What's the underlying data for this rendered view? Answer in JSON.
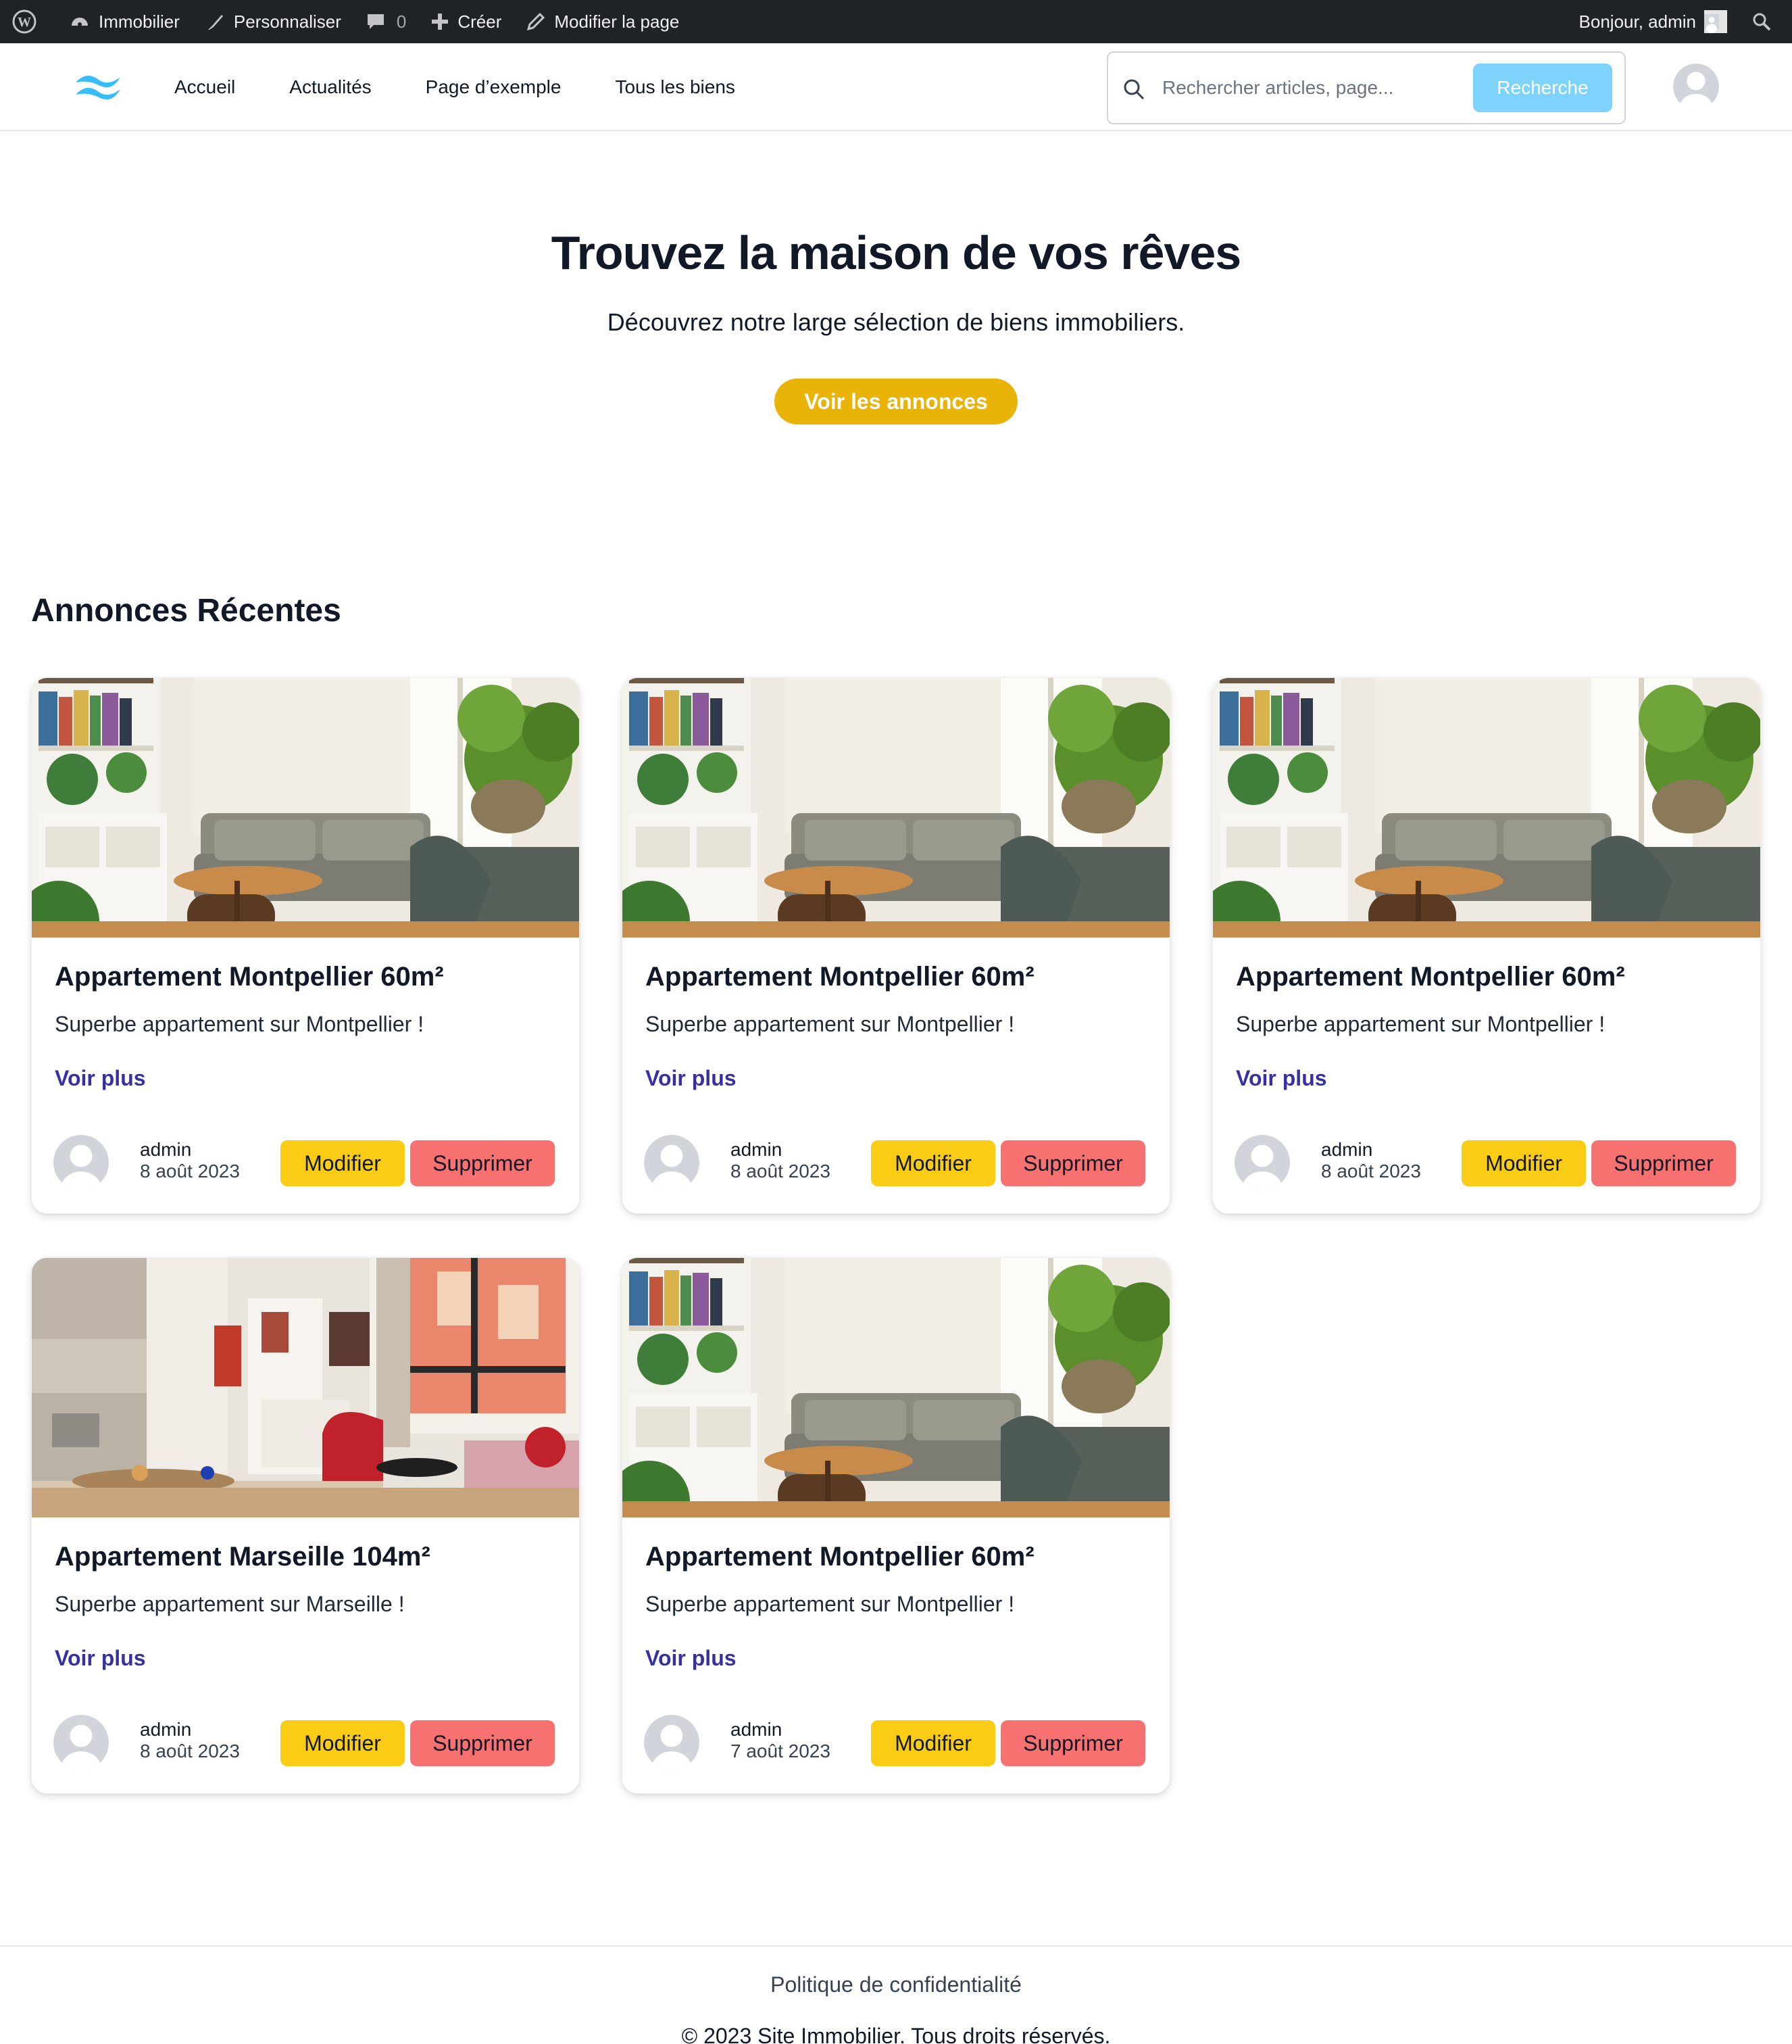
{
  "admin_bar": {
    "site_name": "Immobilier",
    "customize": "Personnaliser",
    "comments_count": "0",
    "create": "Créer",
    "edit_page": "Modifier la page",
    "greeting": "Bonjour, admin"
  },
  "header": {
    "nav": [
      "Accueil",
      "Actualités",
      "Page d’exemple",
      "Tous les biens"
    ],
    "search_placeholder": "Rechercher articles, page...",
    "search_button": "Recherche"
  },
  "hero": {
    "title": "Trouvez la maison de vos rêves",
    "subtitle": "Découvrez notre large sélection de biens immobiliers.",
    "button": "Voir les annonces"
  },
  "listings": {
    "section_title": "Annonces Récentes",
    "more_label": "Voir plus",
    "edit_label": "Modifier",
    "delete_label": "Supprimer",
    "items": [
      {
        "title": "Appartement Montpellier 60m²",
        "description": "Superbe appartement sur Montpellier !",
        "author": "admin",
        "date": "8 août 2023",
        "image": "living-room-plants"
      },
      {
        "title": "Appartement Montpellier 60m²",
        "description": "Superbe appartement sur Montpellier !",
        "author": "admin",
        "date": "8 août 2023",
        "image": "living-room-plants"
      },
      {
        "title": "Appartement Montpellier 60m²",
        "description": "Superbe appartement sur Montpellier !",
        "author": "admin",
        "date": "8 août 2023",
        "image": "living-room-plants"
      },
      {
        "title": "Appartement Marseille 104m²",
        "description": "Superbe appartement sur Marseille !",
        "author": "admin",
        "date": "8 août 2023",
        "image": "living-room-red-armchair"
      },
      {
        "title": "Appartement Montpellier 60m²",
        "description": "Superbe appartement sur Montpellier !",
        "author": "admin",
        "date": "7 août 2023",
        "image": "living-room-plants"
      }
    ]
  },
  "footer": {
    "privacy": "Politique de confidentialité",
    "copyright": "© 2023 Site Immobilier. Tous droits réservés."
  },
  "colors": {
    "admin_bar": "#1d2327",
    "accent_yellow": "#eab308",
    "edit_button": "#facc15",
    "delete_button": "#f87171",
    "link": "#3730a3",
    "search_button": "#7dd3fc"
  }
}
